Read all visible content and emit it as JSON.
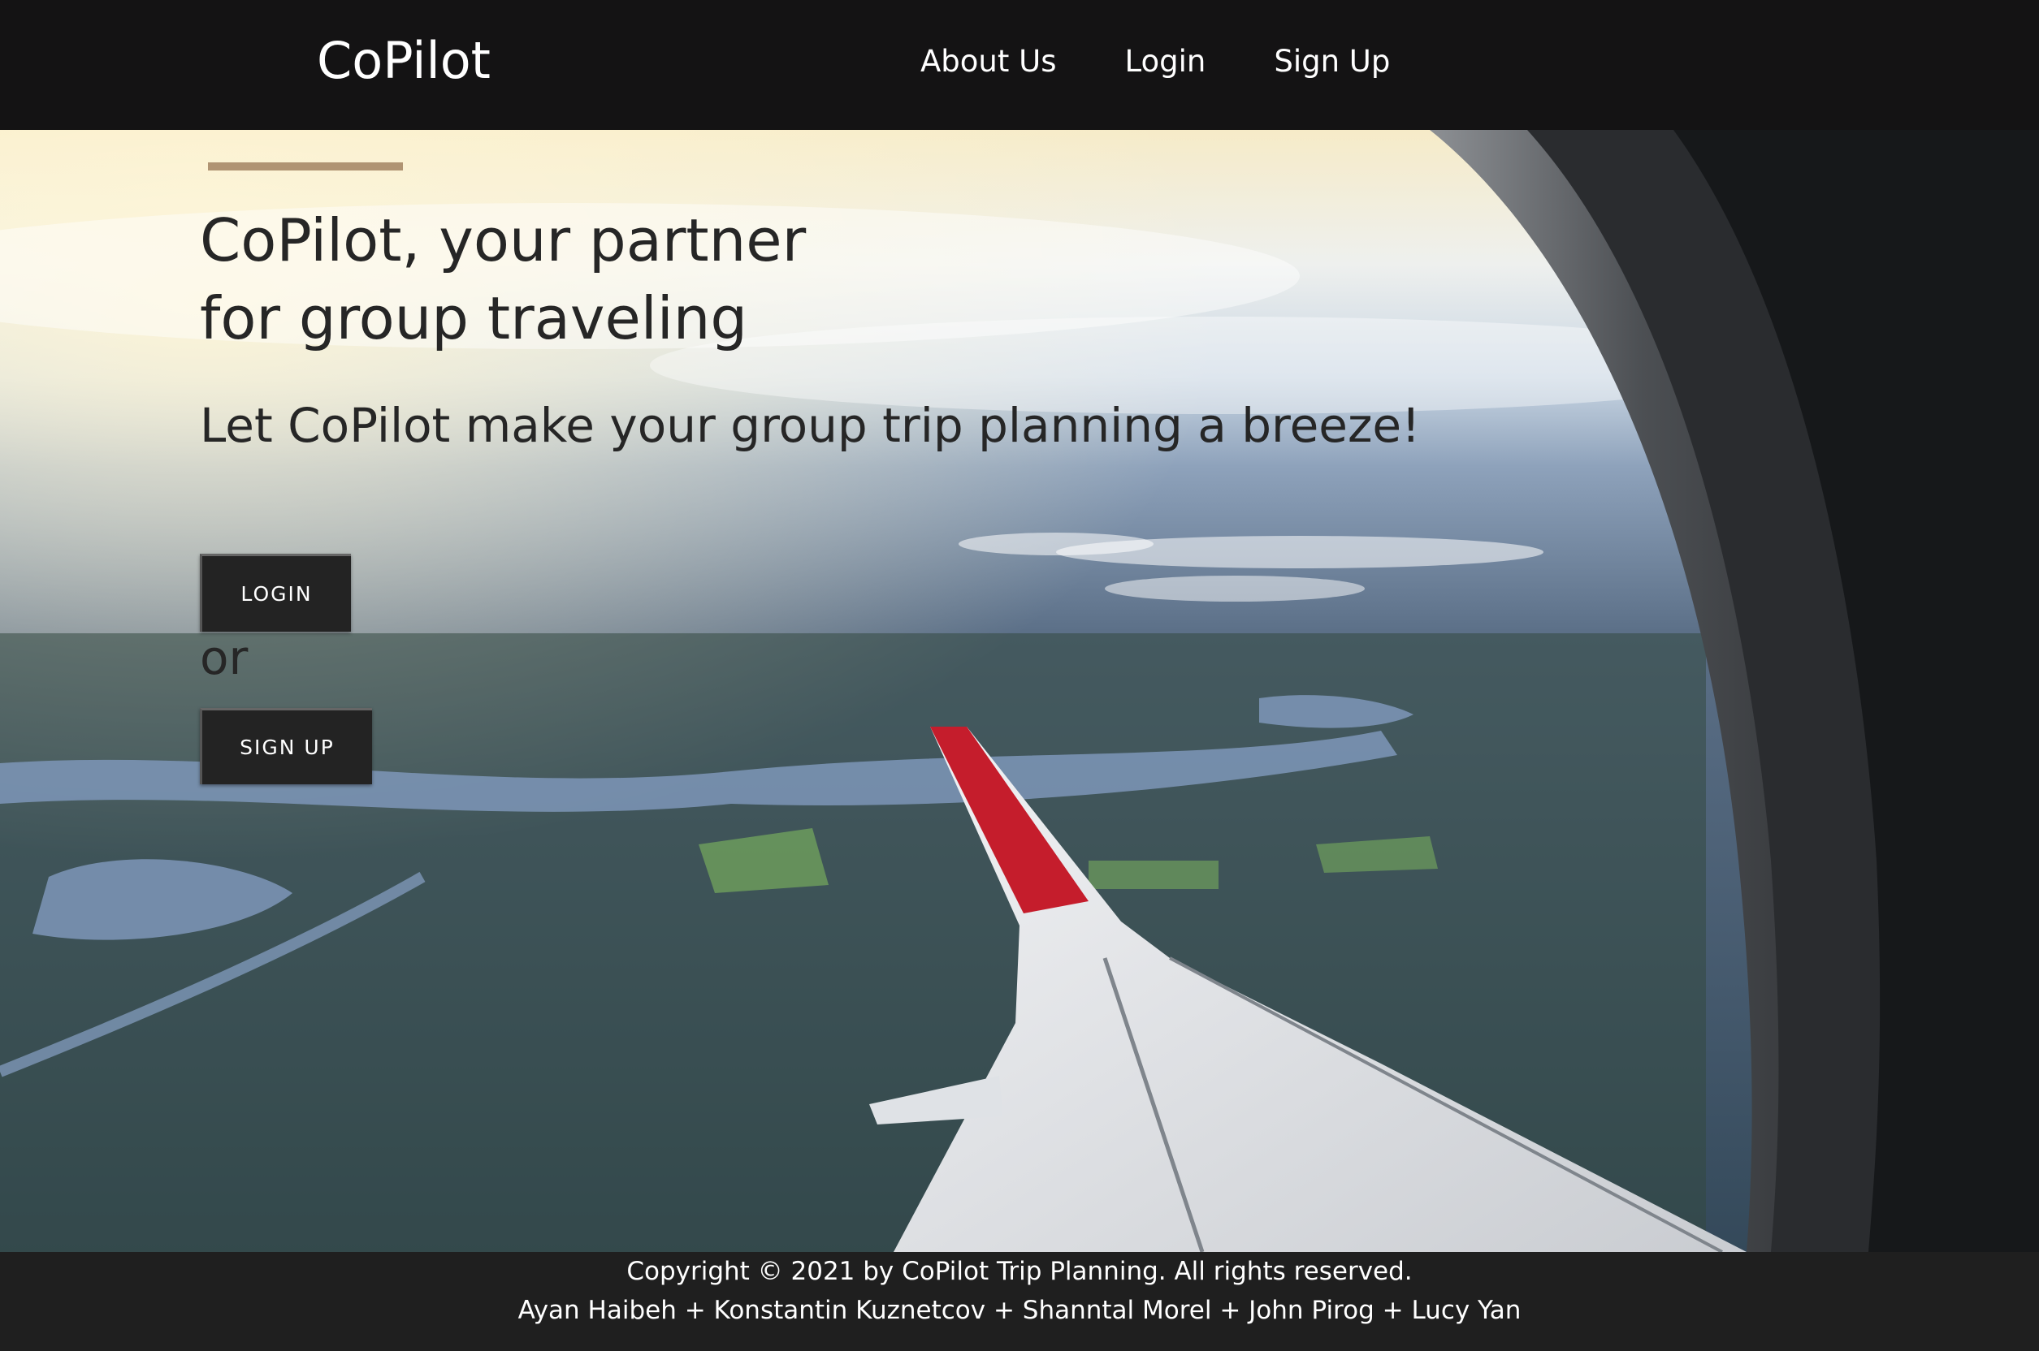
{
  "header": {
    "brand": "CoPilot",
    "nav": [
      {
        "label": "About Us"
      },
      {
        "label": "Login"
      },
      {
        "label": "Sign Up"
      }
    ]
  },
  "hero": {
    "headline_line1": "CoPilot, your partner",
    "headline_line2": "for group traveling",
    "tagline": "Let CoPilot make your group trip planning a breeze!",
    "login_button": "LOGIN",
    "or_text": "or",
    "signup_button": "SIGN UP"
  },
  "footer": {
    "copyright": "Copyright © 2021 by CoPilot Trip Planning. All rights reserved.",
    "credits": "Ayan Haibeh + Konstantin Kuznetcov + Shanntal Morel + John Pirog + Lucy Yan"
  },
  "colors": {
    "header_bg": "#141314",
    "footer_bg": "#1f1f1f",
    "accent": "#b09473",
    "button_bg": "#232323",
    "text_dark": "#262626"
  }
}
